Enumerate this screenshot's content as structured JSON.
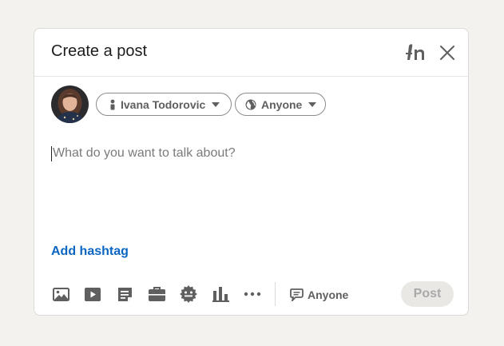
{
  "dialog": {
    "title": "Create a post",
    "brand_icon": "ai-writing-assist-icon",
    "close_icon": "close-icon"
  },
  "author": {
    "name": "Ivana Todorovic",
    "avatar_icon": "profile-photo"
  },
  "audience": {
    "label": "Anyone",
    "icon": "globe-icon"
  },
  "editor": {
    "placeholder": "What do you want to talk about?"
  },
  "add_hashtag_label": "Add hashtag",
  "toolbar": {
    "tools": [
      {
        "name": "photo-icon"
      },
      {
        "name": "video-icon"
      },
      {
        "name": "document-icon"
      },
      {
        "name": "job-briefcase-icon"
      },
      {
        "name": "celebrate-badge-icon"
      },
      {
        "name": "poll-chart-icon"
      },
      {
        "name": "more-icon"
      }
    ],
    "comment_control": {
      "label": "Anyone",
      "icon": "comment-icon"
    },
    "post_label": "Post"
  },
  "colors": {
    "accent_link": "#0a66c2",
    "post_disabled_bg": "#eae8e4",
    "post_disabled_text": "#a9a9a9",
    "text_secondary": "#5f5f5f"
  }
}
